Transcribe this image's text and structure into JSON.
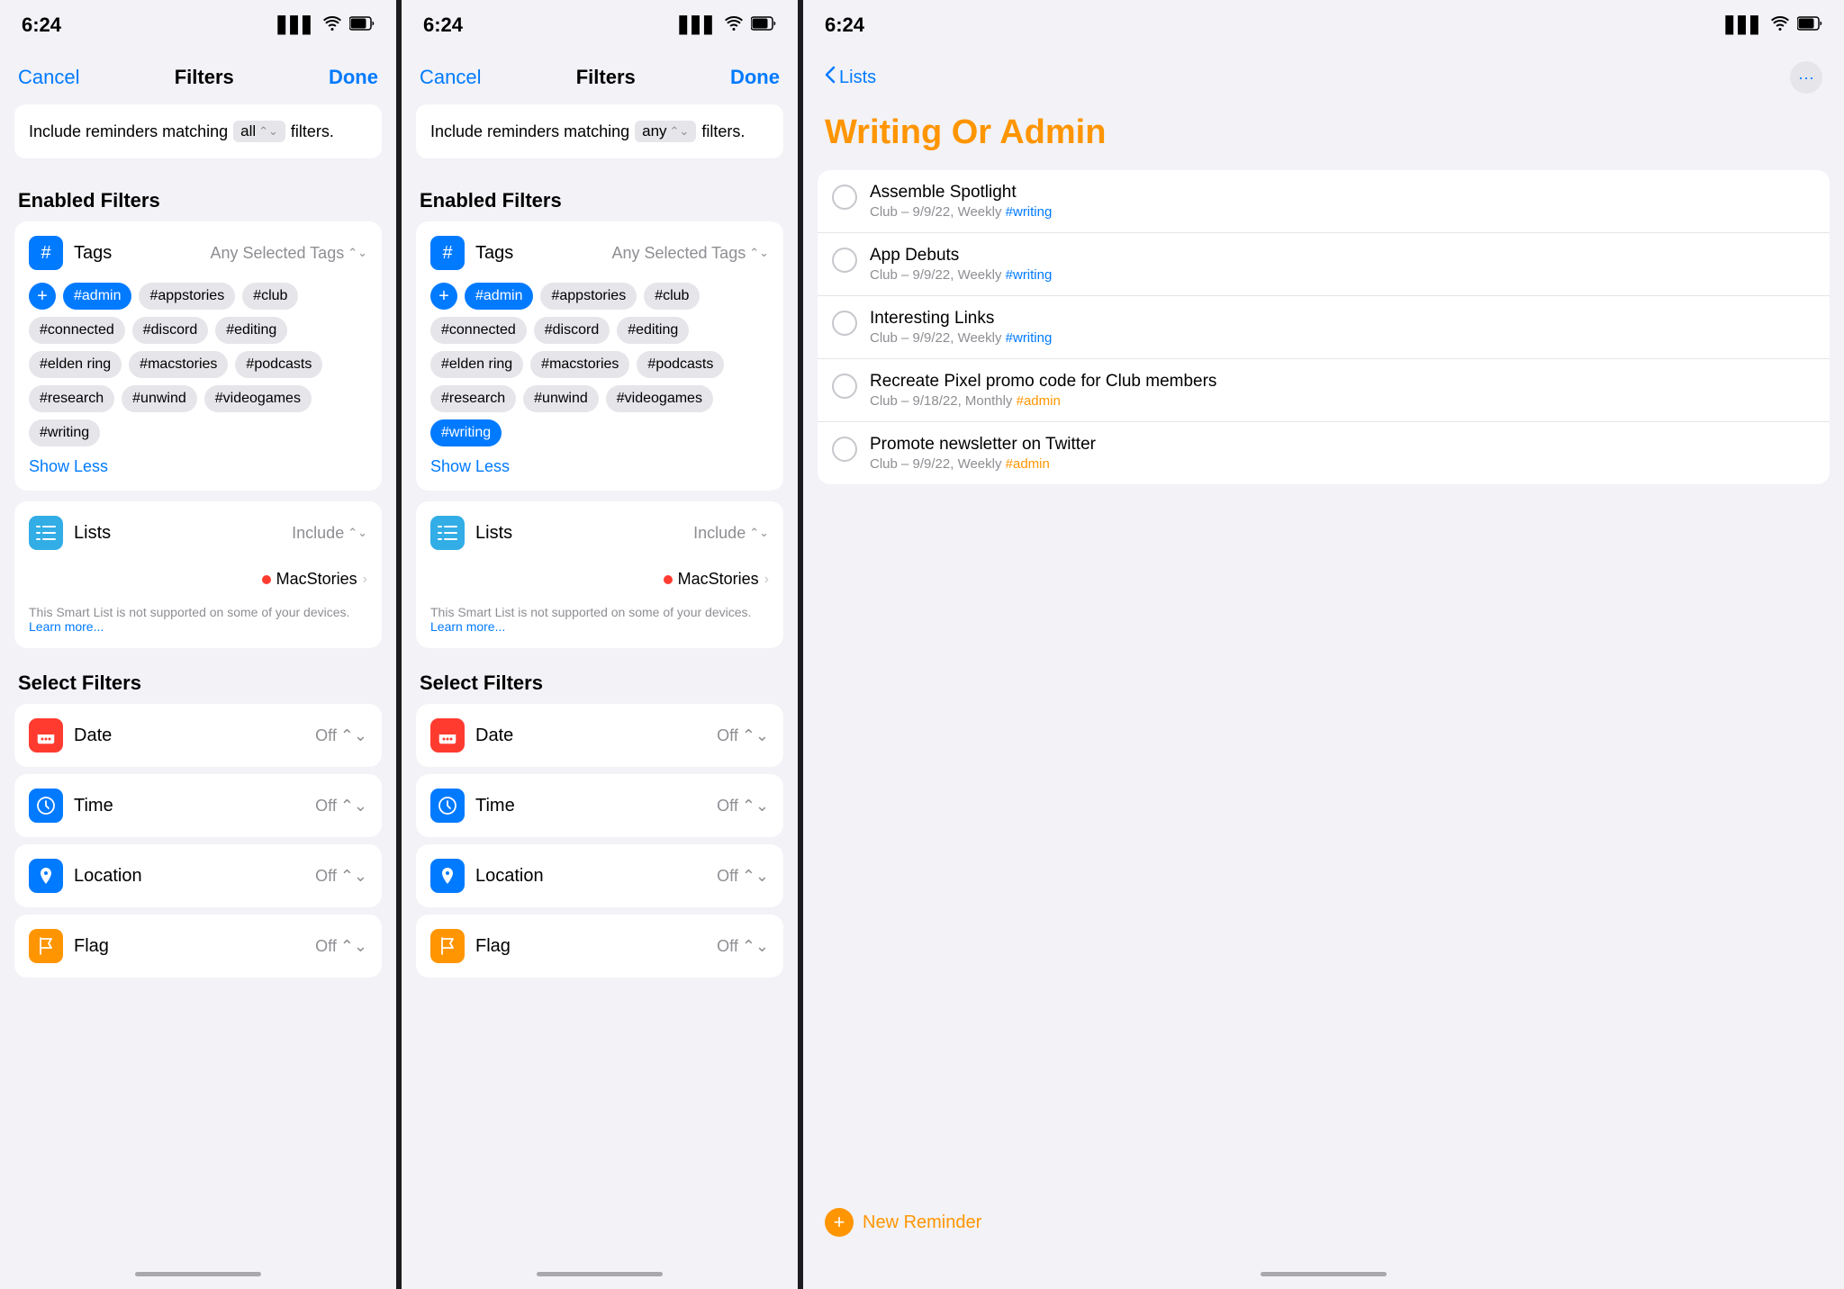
{
  "statusBar": {
    "time": "6:24",
    "signal": "▋▋▋",
    "wifi": "wifi",
    "battery": "battery"
  },
  "panel1": {
    "nav": {
      "cancel": "Cancel",
      "title": "Filters",
      "done": "Done"
    },
    "matchFilter": {
      "prefix": "Include reminders matching",
      "value": "all",
      "suffix": "filters."
    },
    "enabledFilters": {
      "header": "Enabled Filters"
    },
    "tagsFilter": {
      "label": "Tags",
      "value": "Any Selected Tags",
      "tags": [
        "#admin",
        "#appstories",
        "#club",
        "#connected",
        "#discord",
        "#editing",
        "#elden ring",
        "#macstories",
        "#podcasts",
        "#research",
        "#unwind",
        "#videogames",
        "#writing"
      ],
      "selectedTags": [
        "#admin"
      ],
      "showLess": "Show Less"
    },
    "listsFilter": {
      "label": "Lists",
      "value": "Include",
      "listItem": "MacStories",
      "warningText": "This Smart List is not supported on some of your devices.",
      "learnMore": "Learn more..."
    },
    "selectFilters": {
      "header": "Select Filters",
      "items": [
        {
          "label": "Date",
          "value": "Off",
          "iconType": "red",
          "iconChar": "📅"
        },
        {
          "label": "Time",
          "value": "Off",
          "iconType": "blue",
          "iconChar": "🕐"
        },
        {
          "label": "Location",
          "value": "Off",
          "iconType": "blue2",
          "iconChar": "✈"
        },
        {
          "label": "Flag",
          "value": "Off",
          "iconType": "orange",
          "iconChar": "🏷"
        }
      ]
    }
  },
  "panel2": {
    "nav": {
      "cancel": "Cancel",
      "title": "Filters",
      "done": "Done"
    },
    "matchFilter": {
      "prefix": "Include reminders matching",
      "value": "any",
      "suffix": "filters."
    },
    "enabledFilters": {
      "header": "Enabled Filters"
    },
    "tagsFilter": {
      "label": "Tags",
      "value": "Any Selected Tags",
      "tags": [
        "#admin",
        "#appstories",
        "#club",
        "#connected",
        "#discord",
        "#editing",
        "#elden ring",
        "#macstories",
        "#podcasts",
        "#research",
        "#unwind",
        "#videogames",
        "#writing"
      ],
      "selectedTags": [
        "#admin",
        "#writing"
      ],
      "showLess": "Show Less"
    },
    "listsFilter": {
      "label": "Lists",
      "value": "Include",
      "listItem": "MacStories",
      "warningText": "This Smart List is not supported on some of your devices.",
      "learnMore": "Learn more..."
    },
    "selectFilters": {
      "header": "Select Filters",
      "items": [
        {
          "label": "Date",
          "value": "Off",
          "iconType": "red",
          "iconChar": "📅"
        },
        {
          "label": "Time",
          "value": "Off",
          "iconType": "blue",
          "iconChar": "🕐"
        },
        {
          "label": "Location",
          "value": "Off",
          "iconType": "blue2",
          "iconChar": "✈"
        },
        {
          "label": "Flag",
          "value": "Off",
          "iconType": "orange",
          "iconChar": "🏷"
        }
      ]
    }
  },
  "panel3": {
    "nav": {
      "back": "Lists",
      "moreIcon": "···"
    },
    "listTitle": "Writing Or Admin",
    "reminders": [
      {
        "title": "Assemble Spotlight",
        "subtitle": "Club – 9/9/22, Weekly",
        "tag": "#writing",
        "tagType": "writing"
      },
      {
        "title": "App Debuts",
        "subtitle": "Club – 9/9/22, Weekly",
        "tag": "#writing",
        "tagType": "writing"
      },
      {
        "title": "Interesting Links",
        "subtitle": "Club – 9/9/22, Weekly",
        "tag": "#writing",
        "tagType": "writing"
      },
      {
        "title": "Recreate Pixel promo code for Club members",
        "subtitle": "Club – 9/18/22, Monthly",
        "tag": "#admin",
        "tagType": "admin"
      },
      {
        "title": "Promote newsletter on Twitter",
        "subtitle": "Club – 9/9/22, Weekly",
        "tag": "#admin",
        "tagType": "admin"
      }
    ],
    "newReminder": "New Reminder"
  }
}
